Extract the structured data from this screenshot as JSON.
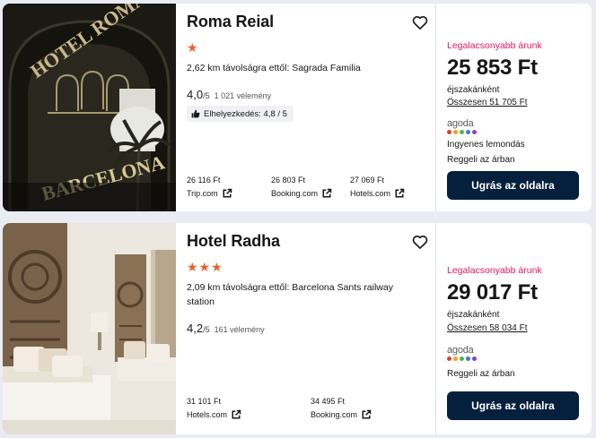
{
  "hotels": [
    {
      "name": "Roma Reial",
      "stars": "★",
      "distance": "2,62 km távolságra ettől: Sagrada Familia",
      "rating": "4,0",
      "rating_denominator": "/5",
      "reviews": "1 021 vélemény",
      "badge": "Elhelyezkedés: 4,8 / 5",
      "prices": [
        {
          "value": "26 116 Ft",
          "provider": "Trip.com"
        },
        {
          "value": "26 803 Ft",
          "provider": "Booking.com"
        },
        {
          "value": "27 069 Ft",
          "provider": "Hotels.com"
        }
      ],
      "deal": {
        "lowest_label": "Legalacsonyabb árunk",
        "price": "25 853 Ft",
        "per_night": "éjszakánként",
        "total": "Összesen 51 705 Ft",
        "provider": "agoda",
        "features": [
          "Ingyenes lemondás",
          "Reggeli az árban"
        ],
        "button": "Ugrás az oldalra"
      }
    },
    {
      "name": "Hotel Radha",
      "stars": "★★★",
      "distance": "2,09 km távolságra ettől: Barcelona Sants railway station",
      "rating": "4,2",
      "rating_denominator": "/5",
      "reviews": "161 vélemény",
      "prices": [
        {
          "value": "31 101 Ft",
          "provider": "Hotels.com"
        },
        {
          "value": "34 495 Ft",
          "provider": "Booking.com"
        }
      ],
      "deal": {
        "lowest_label": "Legalacsonyabb árunk",
        "price": "29 017 Ft",
        "per_night": "éjszakánként",
        "total": "Összesen 58 034 Ft",
        "provider": "agoda",
        "features": [
          "Reggeli az árban"
        ],
        "button": "Ugrás az oldalra"
      }
    }
  ],
  "photo1_sign": [
    "HOTEL ROMA RE",
    "BARCELONA"
  ],
  "colors": {
    "star": "#e7612a",
    "accent_pink": "#e4165c",
    "button_bg": "#05203c",
    "agoda_dots": [
      "#e23a3a",
      "#f6a01a",
      "#4fb848",
      "#3b7bd9",
      "#8e44ad"
    ]
  }
}
